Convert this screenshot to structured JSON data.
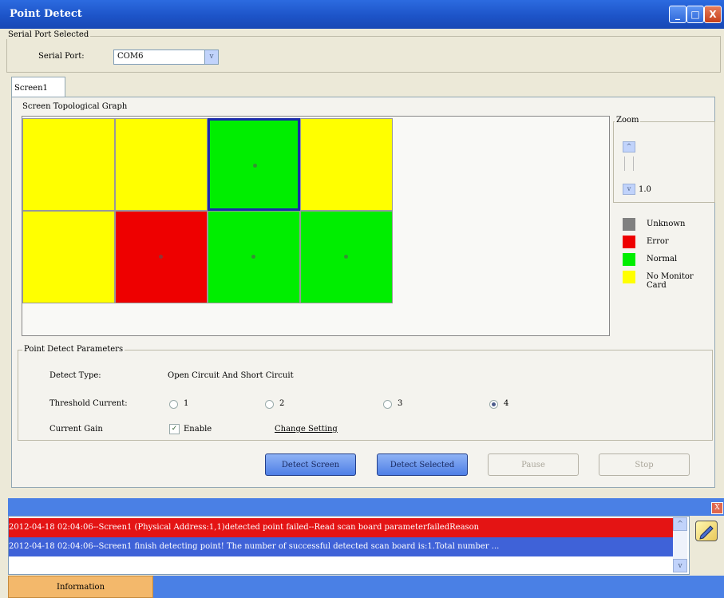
{
  "window": {
    "title": "Point Detect",
    "controls": [
      "_",
      "□",
      "X"
    ]
  },
  "serial_port_group": {
    "legend": "Serial Port Selected",
    "label": "Serial Port:",
    "value": "COM6",
    "arrow": "v"
  },
  "tabs": [
    {
      "label": "Screen1"
    }
  ],
  "topology": {
    "legend": "Screen Topological Graph",
    "cells": [
      {
        "status": "No Monitor Card",
        "color": "#ffff00",
        "dot": false
      },
      {
        "status": "No Monitor Card",
        "color": "#ffff00",
        "dot": false
      },
      {
        "status": "Normal",
        "color": "#00ee00",
        "dot": true,
        "selected": true
      },
      {
        "status": "No Monitor Card",
        "color": "#ffff00",
        "dot": false
      },
      {
        "status": "No Monitor Card",
        "color": "#ffff00",
        "dot": false
      },
      {
        "status": "Error",
        "color": "#ee0000",
        "dot": true
      },
      {
        "status": "Normal",
        "color": "#00ee00",
        "dot": true
      },
      {
        "status": "Normal",
        "color": "#00ee00",
        "dot": true
      }
    ]
  },
  "zoom": {
    "legend": "Zoom",
    "up": "^",
    "down": "v",
    "value": "1.0"
  },
  "legend_items": [
    {
      "label": "Unknown",
      "color": "#808080"
    },
    {
      "label": "Error",
      "color": "#ee0000"
    },
    {
      "label": "Normal",
      "color": "#00ee00"
    },
    {
      "label": "No Monitor Card",
      "color": "#ffff00"
    }
  ],
  "params": {
    "legend": "Point Detect Parameters",
    "detect_type_label": "Detect Type:",
    "detect_type_value": "Open Circuit And Short Circuit",
    "threshold_label": "Threshold Current:",
    "threshold_options": [
      "1",
      "2",
      "3",
      "4"
    ],
    "threshold_selected": "4",
    "gain_label": "Current Gain",
    "gain_enable_label": "Enable",
    "gain_enabled": true,
    "check_mark": "✓",
    "change_setting": "Change Setting"
  },
  "buttons": {
    "detect_screen": "Detect Screen",
    "detect_selected": "Detect Selected",
    "pause": "Pause",
    "stop": "Stop"
  },
  "log": {
    "close": "X",
    "lines": [
      {
        "text": "2012-04-18 02:04:06--Screen1 (Physical Address:1,1)detected point failed--Read scan board parameterfailedReason",
        "color": "#e41414"
      },
      {
        "text": "2012-04-18 02:04:06--Screen1 finish detecting point! The number of successful detected scan board is:1.Total number ...",
        "color": "#3f62d8"
      }
    ],
    "scroll_up": "^",
    "scroll_down": "v"
  },
  "bottom_tab": "Information"
}
